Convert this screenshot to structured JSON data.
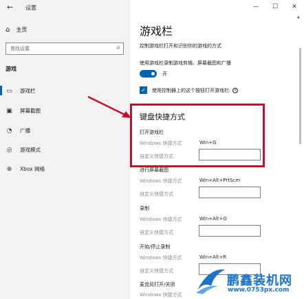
{
  "window": {
    "app_title": "设置",
    "minimize": "—",
    "maximize": "☐",
    "close": "✕"
  },
  "sidebar": {
    "home": "主页",
    "search_placeholder": "查找设置",
    "section": "游戏",
    "items": [
      {
        "label": "游戏栏",
        "icon": "game-bar-icon"
      },
      {
        "label": "屏幕截图",
        "icon": "screenshot-icon"
      },
      {
        "label": "广播",
        "icon": "broadcast-icon"
      },
      {
        "label": "游戏模式",
        "icon": "game-mode-icon"
      },
      {
        "label": "Xbox 网络",
        "icon": "xbox-icon"
      }
    ]
  },
  "main": {
    "title": "游戏栏",
    "description": "控制游戏栏打开和识别你的游戏的方式",
    "toggle_label": "使用游戏栏录制游戏剪辑、屏幕截图和广播",
    "toggle_state": "开",
    "toggle_on": true,
    "checkbox_label": "使用控制器上的这个按钮打开游戏栏:",
    "checkbox_checked": true,
    "shortcuts_title": "键盘快捷方式",
    "windows_shortcut_label": "Windows 快捷方式",
    "custom_shortcut_label": "自定义快捷方式",
    "groups": [
      {
        "title": "打开游戏栏",
        "windows_shortcut": "Win+G"
      },
      {
        "title": "进行屏幕截图",
        "windows_shortcut": "Win+Alt+PrtScm"
      },
      {
        "title": "录制",
        "windows_shortcut": "Win+Alt+G"
      },
      {
        "title": "开始/停止录制",
        "windows_shortcut": "Win+Alt+R"
      },
      {
        "title": "麦克风打开/关闭",
        "windows_shortcut": ""
      }
    ]
  },
  "watermark": {
    "title": "鹏鑫装机网",
    "url": "www.0753px.com"
  },
  "colors": {
    "accent": "#0063b1",
    "highlight": "#c8102e",
    "watermark": "#1a73c8"
  }
}
